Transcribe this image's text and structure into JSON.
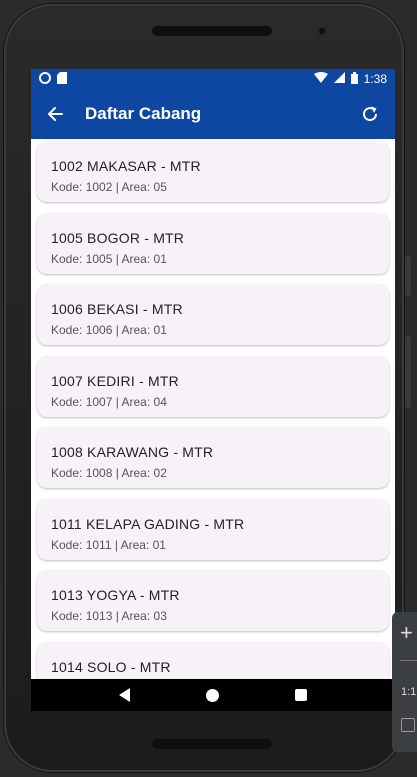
{
  "status_bar": {
    "time": "1:38"
  },
  "app_bar": {
    "title": "Daftar Cabang",
    "back_icon": "arrow-back-icon",
    "refresh_icon": "refresh-icon"
  },
  "colors": {
    "primary": "#0d47a1",
    "card_bg": "#f6f2f8"
  },
  "branches": [
    {
      "name": "1002 MAKASAR - MTR",
      "details": "Kode: 1002 | Area: 05"
    },
    {
      "name": "1005 BOGOR - MTR",
      "details": "Kode: 1005 | Area: 01"
    },
    {
      "name": "1006 BEKASI - MTR",
      "details": "Kode: 1006 | Area: 01"
    },
    {
      "name": "1007 KEDIRI - MTR",
      "details": "Kode: 1007 | Area: 04"
    },
    {
      "name": "1008 KARAWANG - MTR",
      "details": "Kode: 1008 | Area: 02"
    },
    {
      "name": "1011 KELAPA GADING - MTR",
      "details": "Kode: 1011 | Area: 01"
    },
    {
      "name": "1013 YOGYA - MTR",
      "details": "Kode: 1013 | Area: 03"
    },
    {
      "name": "1014 SOLO - MTR",
      "details": ""
    }
  ],
  "emulator_panel": {
    "zoom_label": "1:1"
  }
}
